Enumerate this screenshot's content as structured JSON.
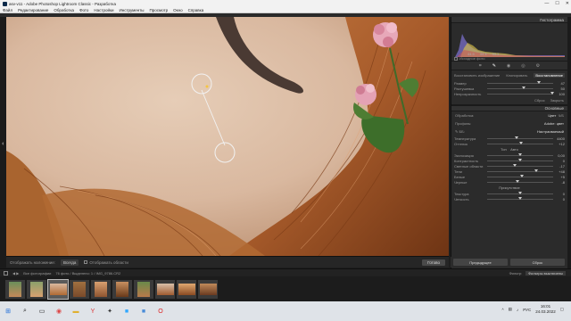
{
  "window": {
    "title": "asv-v11 - Adobe Photoshop Lightroom Classic - Разработка",
    "min": "—",
    "max": "☐",
    "close": "✕"
  },
  "menu": [
    "Файл",
    "Редактирование",
    "Обработка",
    "Фото",
    "Настройки",
    "Инструменты",
    "Просмотр",
    "Окно",
    "Справка"
  ],
  "histogram": {
    "title": "Гистограмма",
    "values": [
      "44.5",
      "44.4",
      "53.3"
    ],
    "checkbox_label": "Исходное фото"
  },
  "tools": {
    "icons": [
      "crop-icon",
      "healing-icon",
      "mask-icon",
      "eye-icon",
      "settings-icon"
    ],
    "glyphs": [
      "⌗",
      "✎",
      "◉",
      "◎",
      "⚙"
    ]
  },
  "mask_tabs": [
    "Восстановить изображение",
    "Клонировать",
    "Восстановление"
  ],
  "brush": {
    "rows": [
      {
        "label": "Размер",
        "value": "47",
        "pos": 0.78
      },
      {
        "label": "Растушевка",
        "value": "50",
        "pos": 0.55
      },
      {
        "label": "Непрозрачность",
        "value": "100",
        "pos": 0.98
      }
    ],
    "actions": [
      "Сброс",
      "Закрыть"
    ]
  },
  "basic": {
    "title": "Основные",
    "treatment_label": "Обработка:",
    "treatment_color": "Цвет",
    "treatment_bw": "Ч/Б",
    "profile_label": "Профиль:",
    "profile_value": "Adobe: цвет",
    "wb_label": "ББ:",
    "wb_value": "Настраиваемый",
    "tone_head": "Тон",
    "auto": "Авто",
    "presence_head": "Присутствие",
    "rows_wb": [
      {
        "label": "Температура",
        "value": "4400",
        "pos": 0.45
      },
      {
        "label": "Оттенок",
        "value": "+12",
        "pos": 0.52
      }
    ],
    "rows_tone": [
      {
        "label": "Экспозиция",
        "value": "0,00",
        "pos": 0.5
      },
      {
        "label": "Контрастность",
        "value": "0",
        "pos": 0.5
      },
      {
        "label": "Светлые области",
        "value": "-17",
        "pos": 0.42
      },
      {
        "label": "Тени",
        "value": "+48",
        "pos": 0.74
      },
      {
        "label": "Белые",
        "value": "+5",
        "pos": 0.53
      },
      {
        "label": "Черные",
        "value": "-8",
        "pos": 0.46
      }
    ],
    "rows_presence": [
      {
        "label": "Текстура",
        "value": "0",
        "pos": 0.5
      },
      {
        "label": "Четкость",
        "value": "0",
        "pos": 0.5
      }
    ]
  },
  "panel_buttons": [
    "Предыдущее",
    "Сброс"
  ],
  "photo_toolbar": {
    "tool_label": "Отображать наложение:",
    "tool_select": "Всегда",
    "show_checkbox": "Отображать области",
    "done": "Готово"
  },
  "filmstrip_bar": {
    "path": "Все фотографии",
    "info": "76 фото / Выделено: 1 / IMG_9786.CR2",
    "filter_label": "Фильтр:",
    "filter_value": "Фильтры выключены"
  },
  "taskbar": {
    "time": "16:01",
    "date": "24.03.2022",
    "lang": "РУС"
  }
}
